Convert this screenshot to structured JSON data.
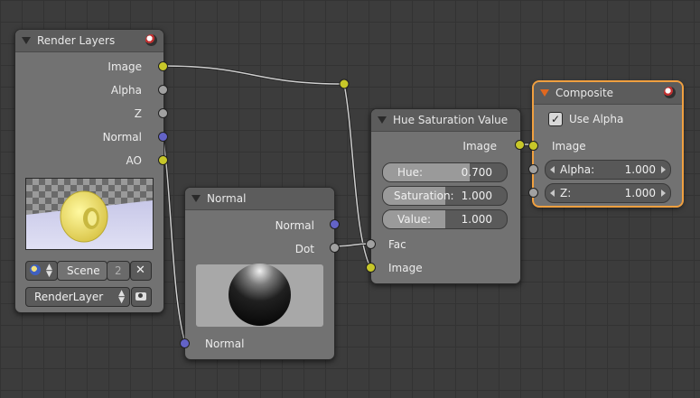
{
  "nodes": {
    "render_layers": {
      "title": "Render Layers",
      "outputs": [
        "Image",
        "Alpha",
        "Z",
        "Normal",
        "AO"
      ],
      "scene": {
        "name": "Scene",
        "users": "2",
        "close": "✕"
      },
      "layer_select": "RenderLayer"
    },
    "normal": {
      "title": "Normal",
      "outputs": [
        "Normal",
        "Dot"
      ],
      "inputs": [
        "Normal"
      ]
    },
    "hue_sat": {
      "title": "Hue Saturation Value",
      "output": "Image",
      "fields": [
        {
          "label": "Hue:",
          "value": "0.700",
          "fraction": 0.7
        },
        {
          "label": "Saturation:",
          "value": "1.000",
          "fraction": 0.5
        },
        {
          "label": "Value:",
          "value": "1.000",
          "fraction": 0.5
        }
      ],
      "inputs": [
        "Fac",
        "Image"
      ]
    },
    "composite": {
      "title": "Composite",
      "use_alpha_label": "Use Alpha",
      "use_alpha": true,
      "checkmark": "✓",
      "inputs": [
        {
          "label": "Image"
        },
        {
          "label": "Alpha:",
          "value": "1.000"
        },
        {
          "label": "Z:",
          "value": "1.000"
        }
      ]
    }
  },
  "colors": {
    "socket_color": "#c7c729",
    "socket_vector": "#6363c7",
    "socket_value": "#a1a1a1",
    "selected_outline": "#f0a040"
  }
}
